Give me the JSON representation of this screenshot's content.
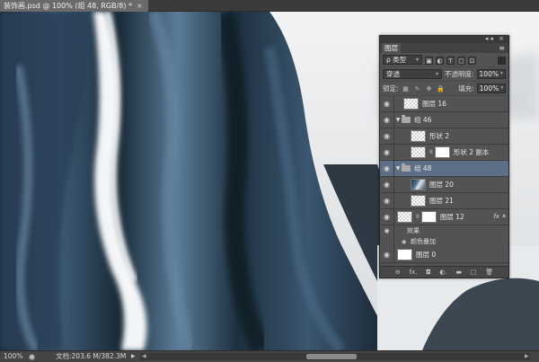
{
  "document": {
    "tab_title": "装饰画.psd @ 100% (组 48, RGB/8) *",
    "close_glyph": "×"
  },
  "statusbar": {
    "zoom": "100%",
    "doc_info": "文档:203.6 M/382.3M",
    "arrow": "▶"
  },
  "layers_panel": {
    "title": "图层",
    "menu_glyph": "≡",
    "collapse_glyph": "◂◂ ×",
    "filter_kind": "ρ 类型",
    "filter_icons": [
      "pixel-filter-icon",
      "adjustment-filter-icon",
      "type-filter-icon",
      "shape-filter-icon",
      "smart-filter-icon"
    ],
    "filter_glyphs": [
      "▣",
      "◐",
      "T",
      "▢",
      "⊡"
    ],
    "blend_mode": "穿透",
    "opacity_label": "不透明度:",
    "opacity_value": "100%",
    "lock_label": "锁定:",
    "lock_glyphs": [
      "▦",
      "✎",
      "✥",
      "🔒"
    ],
    "fill_label": "填充:",
    "fill_value": "100%",
    "effect_header": "效果",
    "effect_item": "颜色叠加",
    "layers": [
      {
        "name": "图层 16"
      },
      {
        "name": "组 46"
      },
      {
        "name": "形状 2"
      },
      {
        "name": "形状 2 副本"
      },
      {
        "name": "组 48"
      },
      {
        "name": "图层 20"
      },
      {
        "name": "图层 21"
      },
      {
        "name": "图层 12",
        "fx": "fx"
      },
      {
        "name": "图层 0"
      }
    ],
    "footer_icons": [
      "link-icon",
      "fx-icon",
      "mask-icon",
      "adjustment-icon",
      "folder-icon",
      "new-layer-icon",
      "trash-icon"
    ],
    "footer_glyphs": [
      "⊖",
      "fx.",
      "◘",
      "◐.",
      "▬",
      "▢",
      "🗑"
    ]
  },
  "colors": {
    "panel_bg": "#535353",
    "selected_row": "#5c6f86",
    "canvas_dark": "#14202b",
    "canvas_blue": "#4a6a88",
    "canvas_light": "#eceeef"
  }
}
